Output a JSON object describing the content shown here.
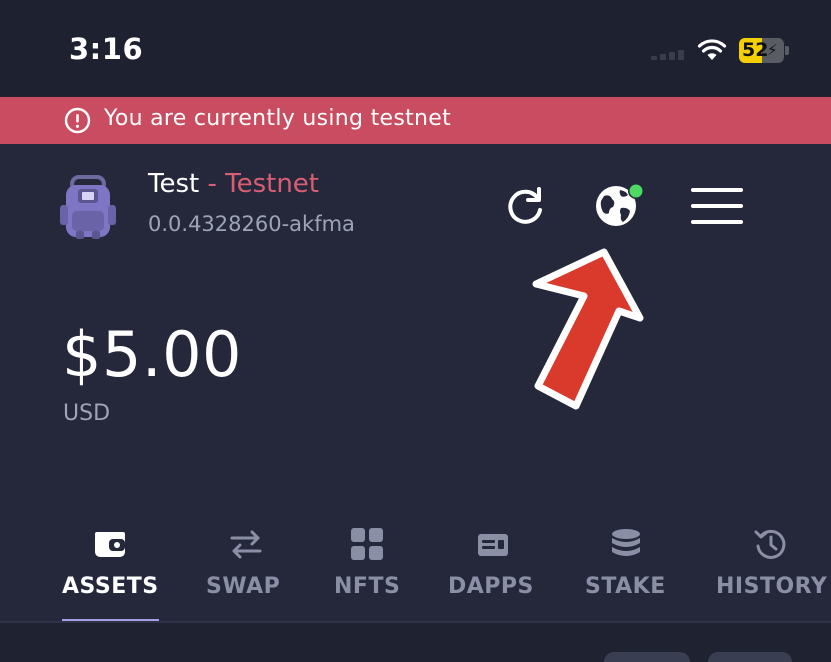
{
  "status_bar": {
    "time": "3:16",
    "battery_level": "52",
    "battery_fraction": 0.52
  },
  "banner": {
    "text": "You are currently using testnet",
    "icon": "alert-circle-icon",
    "color": "#c94c60"
  },
  "account": {
    "name": "Test",
    "separator": " - ",
    "network": "Testnet",
    "id": "0.0.4328260-akfma"
  },
  "header_actions": {
    "refresh_icon": "refresh-icon",
    "network_icon": "globe-icon",
    "menu_icon": "hamburger-menu-icon"
  },
  "balance": {
    "amount": "$5.00",
    "currency": "USD"
  },
  "tabs": [
    {
      "label": "ASSETS",
      "icon": "wallet-icon",
      "active": true
    },
    {
      "label": "SWAP",
      "icon": "swap-arrows-icon",
      "active": false
    },
    {
      "label": "NFTS",
      "icon": "grid-icon",
      "active": false
    },
    {
      "label": "DAPPS",
      "icon": "dapp-card-icon",
      "active": false
    },
    {
      "label": "STAKE",
      "icon": "coin-stack-icon",
      "active": false
    },
    {
      "label": "HISTORY",
      "icon": "history-icon",
      "active": false
    }
  ],
  "colors": {
    "background": "#24283a",
    "accent_testnet": "#d95d73",
    "online_dot": "#4cd964",
    "active_tab_underline": "#a89ee8",
    "annotation_arrow": "#d93a2b"
  }
}
